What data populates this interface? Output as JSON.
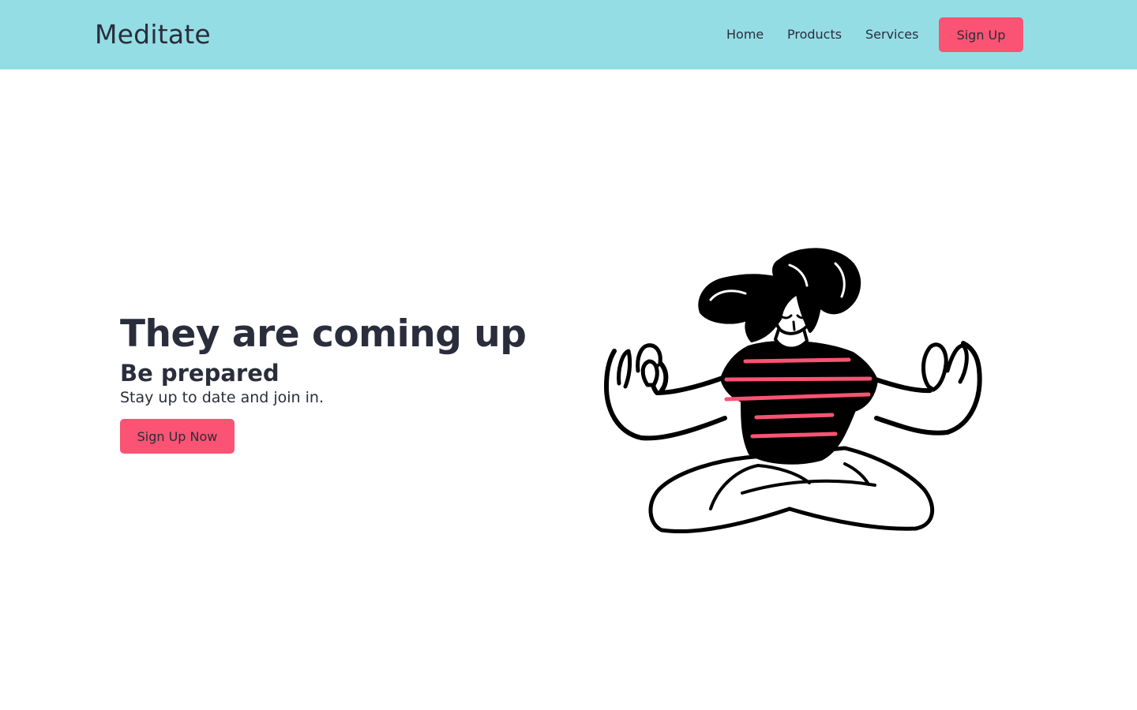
{
  "nav": {
    "brand": "Meditate",
    "links": [
      "Home",
      "Products",
      "Services"
    ],
    "signup_label": "Sign Up"
  },
  "hero": {
    "title": "They are coming up",
    "subtitle": "Be prepared",
    "text": "Stay up to date and join in.",
    "button_label": "Sign Up Now",
    "illustration": "meditating-woman-illustration"
  },
  "colors": {
    "navbar_bg": "#95dde5",
    "accent": "#fa5373",
    "text": "#2a2d3b",
    "background": "#ffffff"
  }
}
